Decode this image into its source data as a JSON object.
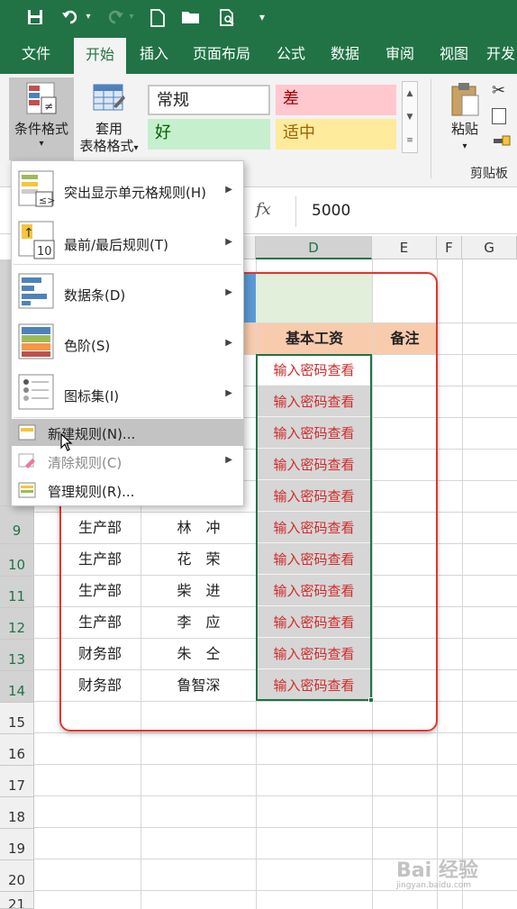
{
  "quick_access": {
    "save": "save-icon",
    "undo": "undo-icon",
    "redo": "redo-icon",
    "new": "new-file-icon",
    "open": "open-folder-icon",
    "preview": "print-preview-icon",
    "customize": "▾"
  },
  "tabs": [
    "文件",
    "开始",
    "插入",
    "页面布局",
    "公式",
    "数据",
    "审阅",
    "视图",
    "开发"
  ],
  "active_tab": "开始",
  "ribbon": {
    "conditional_format": "条件格式",
    "conditional_format_caret": "▾",
    "table_format_line1": "套用",
    "table_format_line2": "表格格式",
    "table_format_caret": "▾",
    "styles": {
      "normal": "常规",
      "bad": "差",
      "good": "好",
      "neutral": "适中"
    },
    "paste": "粘贴",
    "clipboard_group": "剪贴板",
    "colors": {
      "bad_bg": "#ffc7ce",
      "bad_fg": "#9c0006",
      "good_bg": "#c6efce",
      "good_fg": "#006100",
      "neutral_bg": "#ffeb9c",
      "neutral_fg": "#9c6500"
    }
  },
  "formula_bar": {
    "fx": "fx",
    "value": "5000"
  },
  "columns": [
    "D",
    "E",
    "F",
    "G"
  ],
  "row_numbers": [
    "9",
    "10",
    "11",
    "12",
    "13",
    "14",
    "15",
    "16",
    "17",
    "18",
    "19",
    "20",
    "21"
  ],
  "sheet": {
    "header_salary": "基本工资",
    "header_note": "备注",
    "header_colors": {
      "bg": "#f8cbad",
      "band": "#e2efda",
      "blue": "#5b9bd5"
    },
    "masked_value": "输入密码查看",
    "rows": [
      {
        "dept": "生产部",
        "name": "林　冲"
      },
      {
        "dept": "生产部",
        "name": "花　荣"
      },
      {
        "dept": "生产部",
        "name": "柴　进"
      },
      {
        "dept": "生产部",
        "name": "李　应"
      },
      {
        "dept": "财务部",
        "name": "朱　仝"
      },
      {
        "dept": "财务部",
        "name": "鲁智深"
      }
    ]
  },
  "menu": {
    "items": [
      {
        "label": "突出显示单元格规则(H)",
        "has_submenu": true
      },
      {
        "label": "最前/最后规则(T)",
        "has_submenu": true
      },
      {
        "label": "数据条(D)",
        "has_submenu": true
      },
      {
        "label": "色阶(S)",
        "has_submenu": true
      },
      {
        "label": "图标集(I)",
        "has_submenu": true
      }
    ],
    "new_rule": "新建规则(N)...",
    "clear_rules": "清除规则(C)",
    "manage_rules": "管理规则(R)...",
    "submenu_arrow": "▶"
  },
  "watermark": {
    "brand": "Bai 经验",
    "url": "jingyan.baidu.com"
  }
}
